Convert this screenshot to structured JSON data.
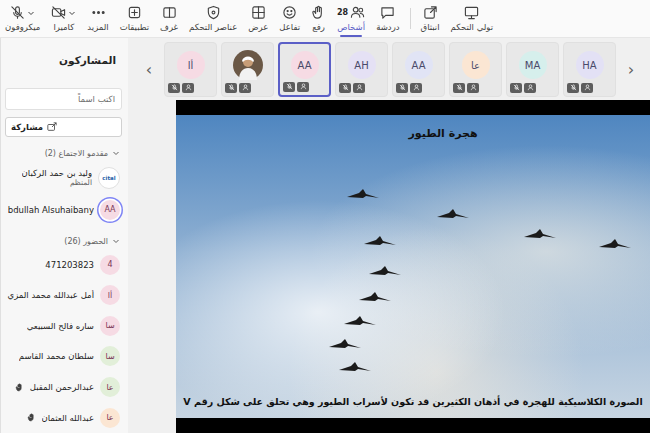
{
  "toolbar": {
    "items": [
      {
        "label": "ميكروفون",
        "kind": "mic",
        "off": true,
        "dropdown": true,
        "separator_before": false,
        "selected": false
      },
      {
        "label": "كاميرا",
        "kind": "camera",
        "off": true,
        "dropdown": true,
        "separator_before": false,
        "selected": false
      },
      {
        "label": "المزيد",
        "kind": "more",
        "off": false,
        "dropdown": false,
        "separator_before": false,
        "selected": false
      },
      {
        "label": "تطبيقات",
        "kind": "apps",
        "off": false,
        "dropdown": false,
        "separator_before": false,
        "selected": false
      },
      {
        "label": "غرف",
        "kind": "rooms",
        "off": false,
        "dropdown": false,
        "separator_before": false,
        "selected": false
      },
      {
        "label": "عناصر التحكم",
        "kind": "controls",
        "off": false,
        "dropdown": false,
        "separator_before": false,
        "selected": false
      },
      {
        "label": "عرض",
        "kind": "view",
        "off": false,
        "dropdown": false,
        "separator_before": false,
        "selected": false
      },
      {
        "label": "تفاعل",
        "kind": "react",
        "off": false,
        "dropdown": false,
        "separator_before": false,
        "selected": false
      },
      {
        "label": "رفع",
        "kind": "raise",
        "off": false,
        "dropdown": false,
        "separator_before": false,
        "selected": false
      },
      {
        "label": "أشخاص",
        "kind": "people",
        "badge": "28",
        "off": false,
        "dropdown": false,
        "separator_before": false,
        "selected": true
      },
      {
        "label": "دردشة",
        "kind": "chat",
        "off": false,
        "dropdown": false,
        "separator_before": false,
        "selected": false
      },
      {
        "label": "انبثاق",
        "kind": "popout",
        "off": false,
        "dropdown": false,
        "separator_before": true,
        "selected": false
      },
      {
        "label": "تولي التحكم",
        "kind": "control",
        "off": false,
        "dropdown": false,
        "separator_before": false,
        "selected": false
      }
    ]
  },
  "participants_panel": {
    "title": "المشاركون",
    "search": {
      "placeholder": "اكتب اسماً"
    },
    "share_button": "مشاركة",
    "sections": [
      {
        "label": "مقدمو الاجتماع (2)",
        "expanded": true,
        "people": [
          {
            "name": "وليد بن حمد الركبان",
            "role": "المنظم",
            "avatar": "cital",
            "color": "#ffffff",
            "speaking": false,
            "hand_raised": false
          },
          {
            "name": "bdullah Alsuhaibany",
            "avatar": "AA",
            "color": "#f6dbe4",
            "speaking": true,
            "hand_raised": false
          }
        ]
      },
      {
        "label": "الحضور (26)",
        "expanded": true,
        "people": [
          {
            "name": "471203823",
            "avatar": "4",
            "color": "#f6dbe4",
            "speaking": false,
            "hand_raised": false
          },
          {
            "name": "أمل عبدالله محمد المزي",
            "avatar": "أا",
            "color": "#f6dbe4",
            "speaking": false,
            "hand_raised": false
          },
          {
            "name": "ساره فالح السبيعي",
            "avatar": "سا",
            "color": "#f6dbe4",
            "speaking": false,
            "hand_raised": false
          },
          {
            "name": "سلطان محمد القاسم",
            "avatar": "سا",
            "color": "#e2efd9",
            "speaking": false,
            "hand_raised": false
          },
          {
            "name": "عبدالرحمن المقبل",
            "avatar": "عا",
            "color": "#e2efd9",
            "speaking": false,
            "hand_raised": true
          },
          {
            "name": "عبدالله العثمان",
            "avatar": "عا",
            "color": "#fbe6d3",
            "speaking": false,
            "hand_raised": true
          }
        ]
      }
    ]
  },
  "video_strip": {
    "prev": "‹",
    "next": "›",
    "tiles": [
      {
        "kind": "initials",
        "initials": "أا",
        "color": "#f6dbe4",
        "selected": false,
        "mic_off": true
      },
      {
        "kind": "photo",
        "color": "#6b5846",
        "selected": false,
        "mic_off": true
      },
      {
        "kind": "initials",
        "initials": "AA",
        "color": "#f6dbe4",
        "selected": true,
        "mic_off": true
      },
      {
        "kind": "initials",
        "initials": "AH",
        "color": "#e5e1f5",
        "selected": false,
        "mic_off": true
      },
      {
        "kind": "initials",
        "initials": "AA",
        "color": "#e1e4f5",
        "selected": false,
        "mic_off": true
      },
      {
        "kind": "initials",
        "initials": "عا",
        "color": "#fbe6d3",
        "selected": false,
        "mic_off": true
      },
      {
        "kind": "initials",
        "initials": "MA",
        "color": "#d6efec",
        "selected": false,
        "mic_off": true
      },
      {
        "kind": "initials",
        "initials": "HA",
        "color": "#e3e1f5",
        "selected": false,
        "mic_off": true
      }
    ]
  },
  "shared_screen": {
    "title": "هجرة الطيور",
    "caption": "الصورة الكلاسيكية للهجرة في أذهان الكثيرين قد تكون لأسراب الطيور وهي تحلق على شكل رقم V"
  }
}
